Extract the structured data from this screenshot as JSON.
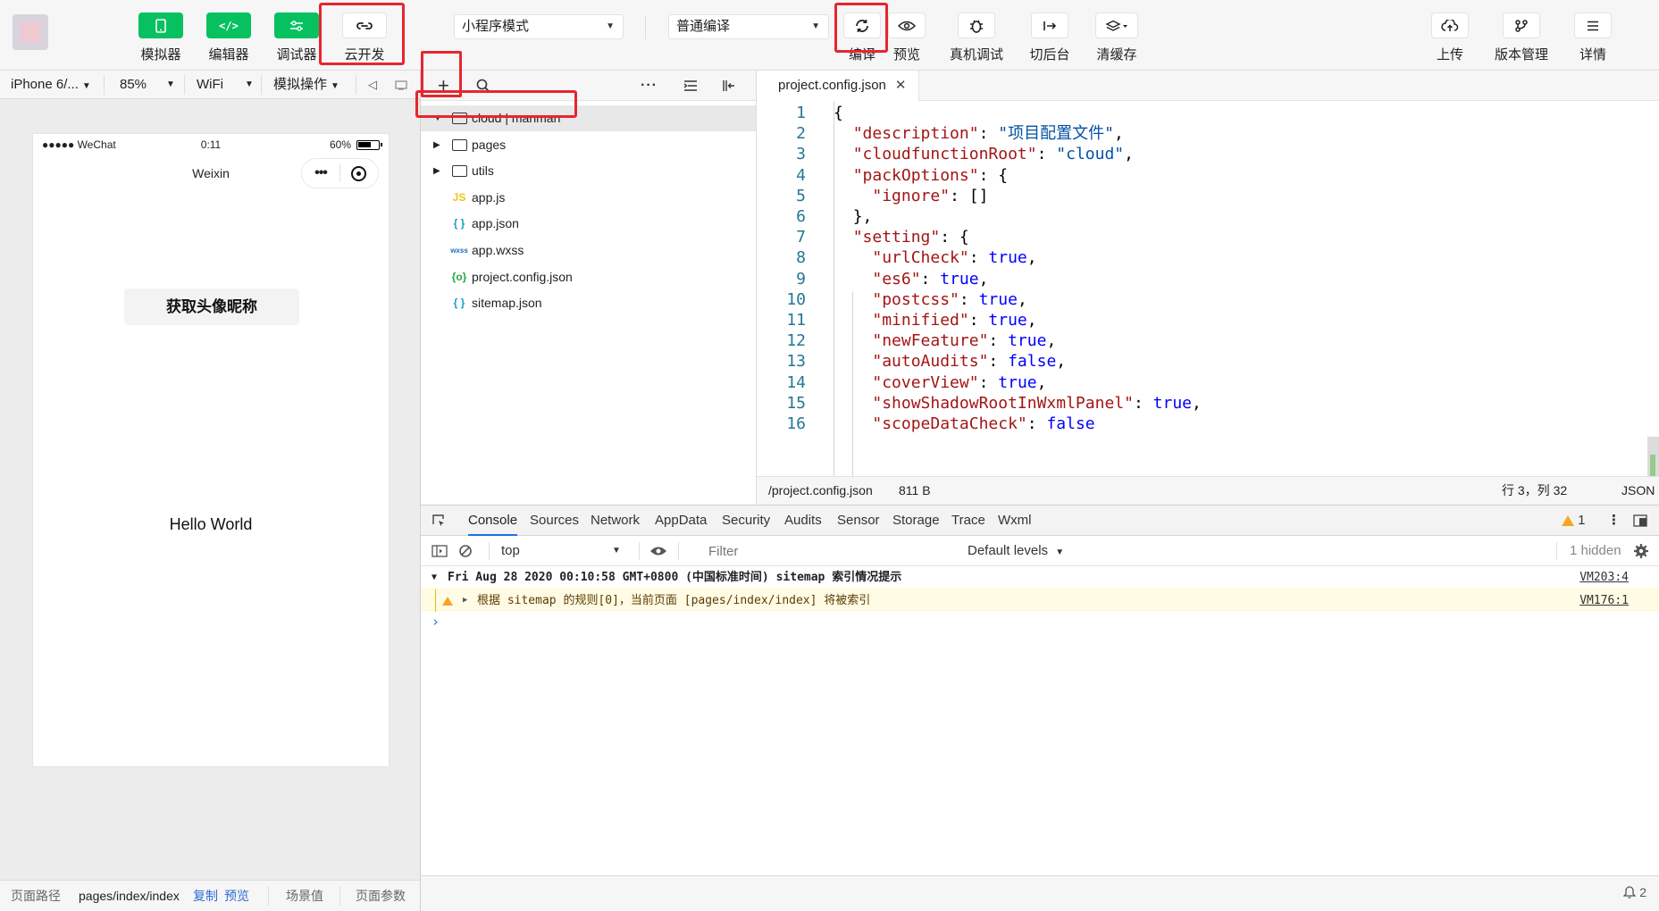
{
  "toolbar": {
    "simulator_label": "模拟器",
    "editor_label": "编辑器",
    "debugger_label": "调试器",
    "cloud_label": "云开发",
    "mode_select": "小程序模式",
    "compile_select": "普通编译",
    "compile_label": "编译",
    "preview_label": "预览",
    "remote_debug_label": "真机调试",
    "background_label": "切后台",
    "clear_cache_label": "清缓存",
    "upload_label": "上传",
    "version_label": "版本管理",
    "details_label": "详情"
  },
  "simulator": {
    "device": "iPhone 6/...",
    "zoom": "85%",
    "network": "WiFi",
    "operations": "模拟操作",
    "status_carrier": "●●●●● WeChat",
    "status_time": "0:11",
    "status_battery": "60%",
    "nav_title": "Weixin",
    "avatar_button": "获取头像昵称",
    "hello_text": "Hello World",
    "footer": {
      "path_label": "页面路径",
      "path_value": "pages/index/index",
      "copy": "复制",
      "preview": "预览",
      "scene": "场景值",
      "params": "页面参数"
    }
  },
  "file_tree": {
    "items": [
      {
        "name": "cloud | manman",
        "type": "cloud-folder",
        "icon": "cloud-folder-icon",
        "expanded": true
      },
      {
        "name": "pages",
        "type": "folder",
        "icon": "folder-icon"
      },
      {
        "name": "utils",
        "type": "folder",
        "icon": "folder-icon"
      },
      {
        "name": "app.js",
        "type": "js",
        "icon_text": "JS",
        "icon_color": "#f0c419"
      },
      {
        "name": "app.json",
        "type": "json",
        "icon_text": "{ }",
        "icon_color": "#1a9bd7"
      },
      {
        "name": "app.wxss",
        "type": "wxss",
        "icon_text": "wxss",
        "icon_color": "#1a6fbf"
      },
      {
        "name": "project.config.json",
        "type": "config",
        "icon_text": "{o}",
        "icon_color": "#2aa646"
      },
      {
        "name": "sitemap.json",
        "type": "json",
        "icon_text": "{ }",
        "icon_color": "#1a9bd7"
      }
    ]
  },
  "editor": {
    "tab": "project.config.json",
    "status_path": "/project.config.json",
    "status_size": "811 B",
    "status_cursor": "行 3，列 32",
    "status_lang": "JSON",
    "lines": [
      {
        "n": "1",
        "indent": "",
        "parts": [
          [
            "p",
            "{"
          ]
        ]
      },
      {
        "n": "2",
        "indent": "  ",
        "parts": [
          [
            "k",
            "\"description\""
          ],
          [
            "p",
            ": "
          ],
          [
            "s",
            "\"项目配置文件\""
          ],
          [
            "p",
            ","
          ]
        ]
      },
      {
        "n": "3",
        "indent": "  ",
        "parts": [
          [
            "k",
            "\"cloudfunctionRoot\""
          ],
          [
            "p",
            ": "
          ],
          [
            "s",
            "\"cloud\""
          ],
          [
            "p",
            ","
          ]
        ]
      },
      {
        "n": "4",
        "indent": "  ",
        "parts": [
          [
            "k",
            "\"packOptions\""
          ],
          [
            "p",
            ": {"
          ]
        ]
      },
      {
        "n": "5",
        "indent": "    ",
        "parts": [
          [
            "k",
            "\"ignore\""
          ],
          [
            "p",
            ": []"
          ]
        ]
      },
      {
        "n": "6",
        "indent": "  ",
        "parts": [
          [
            "p",
            "},"
          ]
        ]
      },
      {
        "n": "7",
        "indent": "  ",
        "parts": [
          [
            "k",
            "\"setting\""
          ],
          [
            "p",
            ": {"
          ]
        ]
      },
      {
        "n": "8",
        "indent": "    ",
        "parts": [
          [
            "k",
            "\"urlCheck\""
          ],
          [
            "p",
            ": "
          ],
          [
            "b",
            "true"
          ],
          [
            "p",
            ","
          ]
        ]
      },
      {
        "n": "9",
        "indent": "    ",
        "parts": [
          [
            "k",
            "\"es6\""
          ],
          [
            "p",
            ": "
          ],
          [
            "b",
            "true"
          ],
          [
            "p",
            ","
          ]
        ]
      },
      {
        "n": "10",
        "indent": "    ",
        "parts": [
          [
            "k",
            "\"postcss\""
          ],
          [
            "p",
            ": "
          ],
          [
            "b",
            "true"
          ],
          [
            "p",
            ","
          ]
        ]
      },
      {
        "n": "11",
        "indent": "    ",
        "parts": [
          [
            "k",
            "\"minified\""
          ],
          [
            "p",
            ": "
          ],
          [
            "b",
            "true"
          ],
          [
            "p",
            ","
          ]
        ]
      },
      {
        "n": "12",
        "indent": "    ",
        "parts": [
          [
            "k",
            "\"newFeature\""
          ],
          [
            "p",
            ": "
          ],
          [
            "b",
            "true"
          ],
          [
            "p",
            ","
          ]
        ]
      },
      {
        "n": "13",
        "indent": "    ",
        "parts": [
          [
            "k",
            "\"autoAudits\""
          ],
          [
            "p",
            ": "
          ],
          [
            "b",
            "false"
          ],
          [
            "p",
            ","
          ]
        ]
      },
      {
        "n": "14",
        "indent": "    ",
        "parts": [
          [
            "k",
            "\"coverView\""
          ],
          [
            "p",
            ": "
          ],
          [
            "b",
            "true"
          ],
          [
            "p",
            ","
          ]
        ]
      },
      {
        "n": "15",
        "indent": "    ",
        "parts": [
          [
            "k",
            "\"showShadowRootInWxmlPanel\""
          ],
          [
            "p",
            ": "
          ],
          [
            "b",
            "true"
          ],
          [
            "p",
            ","
          ]
        ]
      },
      {
        "n": "16",
        "indent": "    ",
        "parts": [
          [
            "k",
            "\"scopeDataCheck\""
          ],
          [
            "p",
            ": "
          ],
          [
            "b",
            "false"
          ]
        ]
      }
    ]
  },
  "devtools": {
    "tabs": [
      "Console",
      "Sources",
      "Network",
      "AppData",
      "Security",
      "Audits",
      "Sensor",
      "Storage",
      "Trace",
      "Wxml"
    ],
    "active_tab": "Console",
    "warning_count": "1",
    "context": "top",
    "filter_placeholder": "Filter",
    "levels": "Default levels",
    "hidden": "1 hidden",
    "footer_count": "2",
    "logs": [
      {
        "kind": "group",
        "text": "Fri Aug 28 2020 00:10:58 GMT+0800 (中国标准时间) sitemap 索引情况提示",
        "source": "VM203:4"
      },
      {
        "kind": "warn",
        "text": "根据 sitemap 的规则[0]，当前页面 [pages/index/index] 将被索引",
        "source": "VM176:1"
      }
    ],
    "prompt": "›"
  },
  "colors": {
    "accent_green": "#07c160",
    "highlight_red": "#e6262f",
    "active_tab_blue": "#1a73e8"
  }
}
